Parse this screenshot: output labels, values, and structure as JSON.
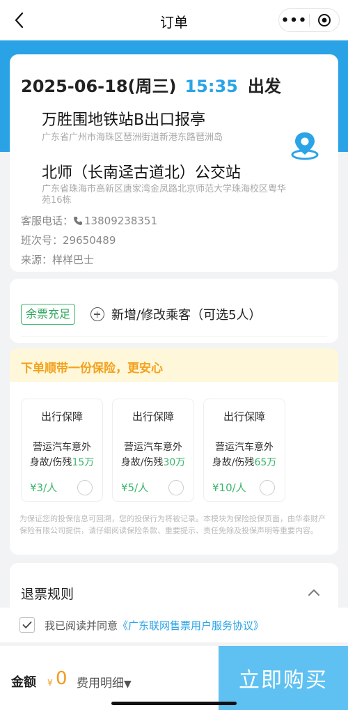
{
  "nav": {
    "title": "订单",
    "more_icon": "more-dots-icon",
    "close_icon": "target-close-icon"
  },
  "trip": {
    "date": "2025-06-18(周三)",
    "time": "15:35",
    "suffix": "出发",
    "origin": {
      "name": "万胜围地铁站B出口报亭",
      "address": "广东省广州市海珠区琶洲街道新港东路琶洲岛"
    },
    "destination": {
      "name": "北师（长南迳古道北）公交站",
      "address": "广东省珠海市高新区唐家湾金凤路北京师范大学珠海校区粤华苑16栋"
    },
    "service_phone_label": "客服电话：",
    "service_phone": "13809238351",
    "schedule_label": "班次号：",
    "schedule_no": "29650489",
    "source_label": "来源：",
    "source": "样样巴士"
  },
  "passenger": {
    "badge": "余票充足",
    "add_label": "新增/修改乘客（可选5人）"
  },
  "insurance": {
    "banner": "下单顺带一份保险，更安心",
    "plans": [
      {
        "title": "出行保障",
        "desc1": "营运汽车意外",
        "desc2_prefix": "身故/伤残",
        "amount": "15万",
        "price": "¥3/人"
      },
      {
        "title": "出行保障",
        "desc1": "营运汽车意外",
        "desc2_prefix": "身故/伤残",
        "amount": "30万",
        "price": "¥5/人"
      },
      {
        "title": "出行保障",
        "desc1": "营运汽车意外",
        "desc2_prefix": "身故/伤残",
        "amount": "65万",
        "price": "¥10/人"
      }
    ],
    "note": "为保证您的投保信息可回溯，您的投保行为将被记录。本模块为保险投保页面，由华泰财产保险有限公司提供，请仔细阅读保险条款、重要提示、责任免除及投保声明等重要内容。"
  },
  "refund": {
    "title": "退票规则"
  },
  "agreement": {
    "prefix": "我已阅读并同意",
    "link": "《广东联网售票用户服务协议》",
    "checked": true
  },
  "bottom": {
    "amount_label": "金额",
    "currency": "¥",
    "amount": "0",
    "fee_detail": "费用明细",
    "buy_label": "立即购买"
  },
  "colors": {
    "primary_blue": "#29a3e6",
    "accent_orange": "#f39a1e",
    "green": "#3ab56a",
    "buy_button": "#5fc1f2"
  }
}
